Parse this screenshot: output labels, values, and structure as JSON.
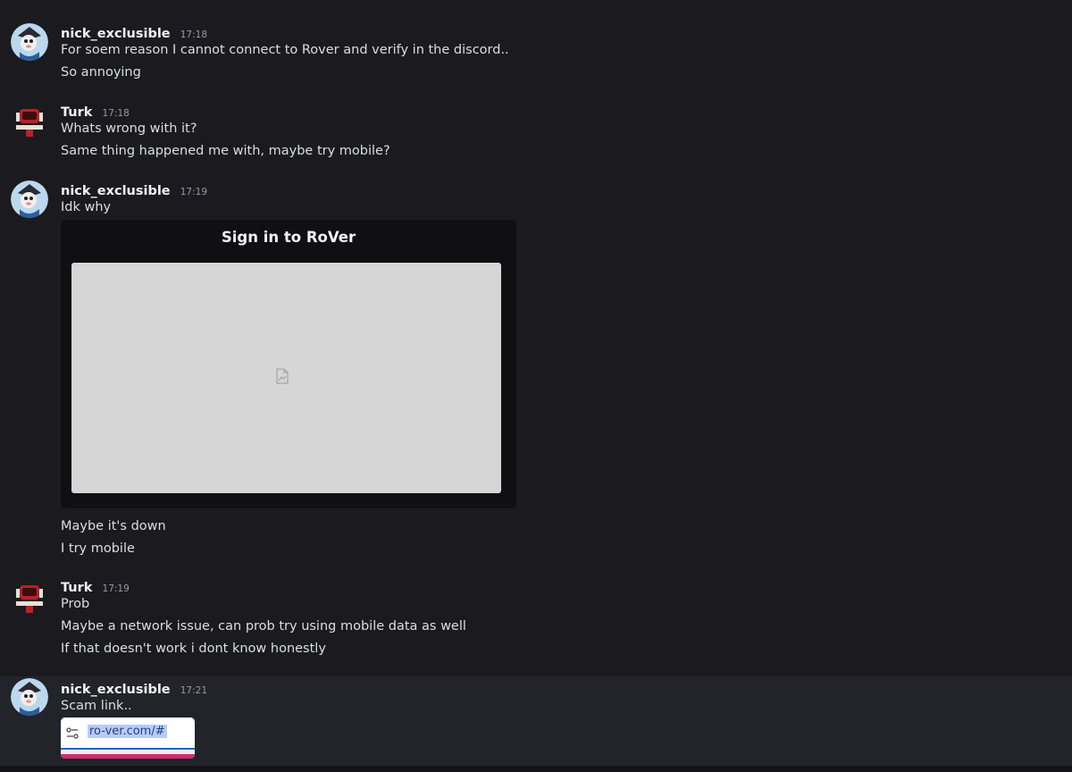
{
  "messages": [
    {
      "username": "nick_exclusible",
      "time": "17:18",
      "lines": [
        "For soem reason I cannot connect to Rover and verify in the discord..",
        "So annoying"
      ]
    },
    {
      "username": "Turk",
      "time": "17:18",
      "lines": [
        "Whats wrong with it?",
        "Same thing happened me with, maybe try mobile?"
      ]
    },
    {
      "username": "nick_exclusible",
      "time": "17:19",
      "lines": [
        "Idk why"
      ],
      "embed": {
        "title": "Sign in to RoVer"
      },
      "after_lines": [
        "Maybe it's down",
        "I try mobile"
      ]
    },
    {
      "username": "Turk",
      "time": "17:19",
      "lines": [
        "Prob",
        "Maybe a network issue, can prob try using mobile data as well",
        "If that doesn't work i dont know honestly"
      ]
    },
    {
      "username": "nick_exclusible",
      "time": "17:21",
      "lines": [
        "Scam link.."
      ],
      "url_screenshot": {
        "url": "ro-ver.com/#"
      }
    }
  ],
  "colors": {
    "background": "#1b1b1f",
    "highlight_row": "#232429",
    "embed_bg": "#101012",
    "username": "#f2f3f5",
    "timestamp": "#949ba4",
    "text": "#dbdee1",
    "url_highlight": "#b8ccf5",
    "url_accent": "#d12b73"
  },
  "icons": {
    "broken_image": "broken-image-icon",
    "url_settings": "tune-icon"
  }
}
